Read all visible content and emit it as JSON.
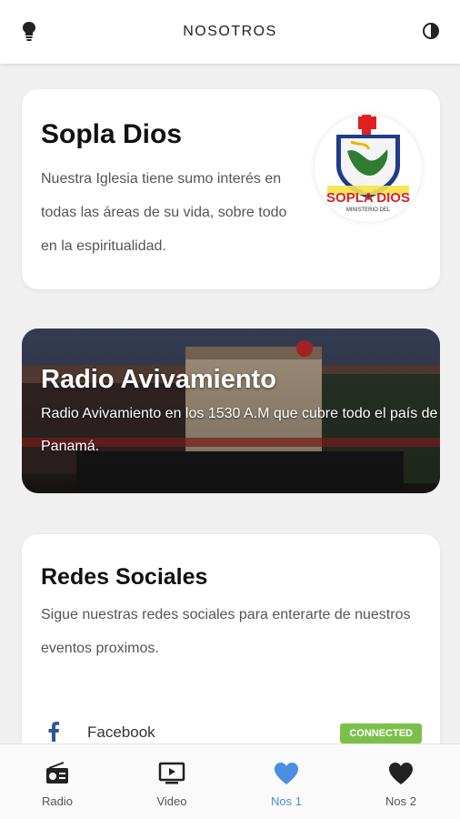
{
  "header": {
    "title": "NOSOTROS",
    "left_icon": "lightbulb-icon",
    "right_icon": "contrast-icon"
  },
  "church": {
    "name": "Sopla Dios",
    "description": "Nuestra Iglesia tiene sumo interés en todas las áreas de su vida, sobre todo en la espiritualidad.",
    "logo_text": "SOPLA DIOS",
    "logo_subtext": "MINISTERIO DEL"
  },
  "radio": {
    "title": "Radio Avivamiento",
    "description": "Radio Avivamiento en los 1530 A.M que cubre todo el país de Panamá."
  },
  "social": {
    "title": "Redes Sociales",
    "description": "Sigue nuestras redes sociales para enterarte de nuestros eventos proximos.",
    "items": [
      {
        "label": "Facebook",
        "icon": "facebook-icon",
        "status": "CONNECTED",
        "status_color": "#7cc04b"
      }
    ]
  },
  "nav": {
    "items": [
      {
        "label": "Radio",
        "icon": "radio-icon"
      },
      {
        "label": "Video",
        "icon": "tv-icon"
      },
      {
        "label": "Nos 1",
        "icon": "heart-icon",
        "active": true
      },
      {
        "label": "Nos 2",
        "icon": "heart-icon"
      }
    ],
    "active_color": "#4a8fe0"
  }
}
